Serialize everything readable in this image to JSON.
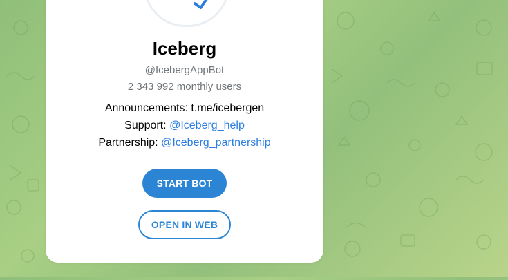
{
  "bot": {
    "name": "Iceberg",
    "username": "@IcebergAppBot",
    "monthly_users": "2 343 992 monthly users"
  },
  "info": {
    "announcements_label": "Announcements:",
    "announcements_value": "t.me/icebergen",
    "support_label": "Support:",
    "support_value": "@Iceberg_help",
    "partnership_label": "Partnership:",
    "partnership_value": "@Iceberg_partnership"
  },
  "actions": {
    "start_label": "START BOT",
    "web_label": "OPEN IN WEB"
  },
  "colors": {
    "accent": "#2b84d4",
    "link": "#2b7ee0",
    "muted_text": "#707579",
    "background": "#9cc77f"
  }
}
